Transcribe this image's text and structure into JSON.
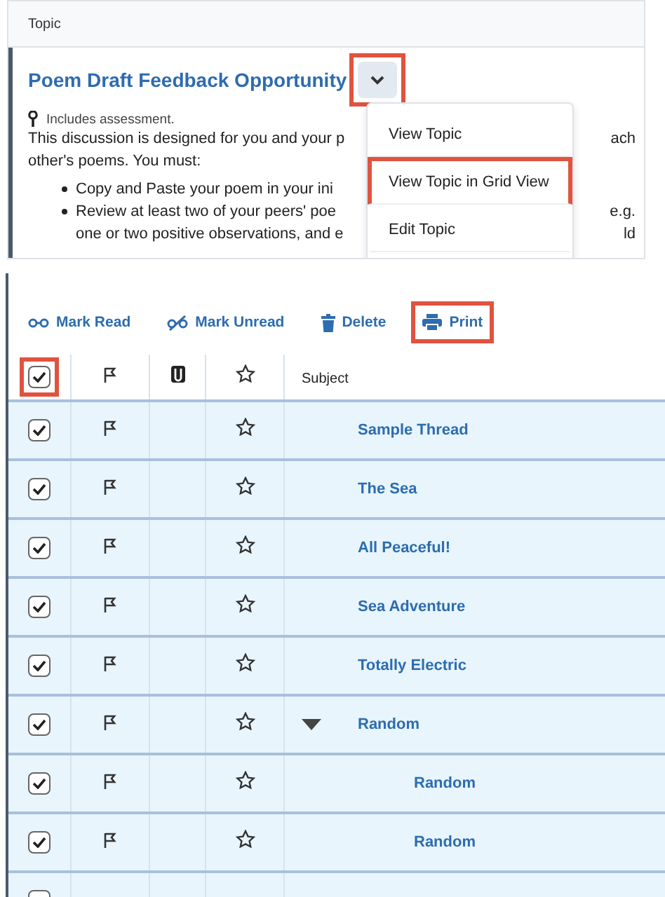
{
  "topic_panel": {
    "header": "Topic",
    "title": "Poem Draft Feedback Opportunity",
    "chevron_button": {
      "highlighted": true
    },
    "assessment_note": "Includes assessment.",
    "paragraph": [
      {
        "left": "This discussion is designed for you and your p",
        "right": "ach"
      },
      {
        "left": "other's poems. You must:"
      }
    ],
    "bullets": [
      {
        "lines": [
          {
            "left": "Copy and Paste your poem in your ini"
          }
        ]
      },
      {
        "lines": [
          {
            "left": "Review at least two of your peers' poe",
            "right": "e.g."
          },
          {
            "left": "one or two positive observations, and e",
            "right": "ld"
          }
        ]
      }
    ],
    "menu": [
      {
        "label": "View Topic",
        "highlighted": false
      },
      {
        "label": "View Topic in Grid View",
        "highlighted": true
      },
      {
        "label": "Edit Topic",
        "highlighted": false
      }
    ]
  },
  "toolbar": [
    {
      "kind": "mark-read",
      "label": "Mark Read",
      "highlighted": false
    },
    {
      "kind": "mark-unread",
      "label": "Mark Unread",
      "highlighted": false
    },
    {
      "kind": "delete",
      "label": "Delete",
      "highlighted": false
    },
    {
      "kind": "print",
      "label": "Print",
      "highlighted": true
    }
  ],
  "table": {
    "header": {
      "checked": true,
      "highlighted": true,
      "subject": "Subject"
    },
    "rows": [
      {
        "checked": true,
        "subject": "Sample Thread"
      },
      {
        "checked": true,
        "subject": "The Sea"
      },
      {
        "checked": true,
        "subject": "All Peaceful!"
      },
      {
        "checked": true,
        "subject": "Sea Adventure"
      },
      {
        "checked": true,
        "subject": "Totally Electric"
      },
      {
        "checked": true,
        "subject": "Random",
        "expanded": true,
        "children": [
          {
            "checked": true,
            "subject": "Random"
          },
          {
            "checked": true,
            "subject": "Random"
          }
        ]
      }
    ]
  }
}
